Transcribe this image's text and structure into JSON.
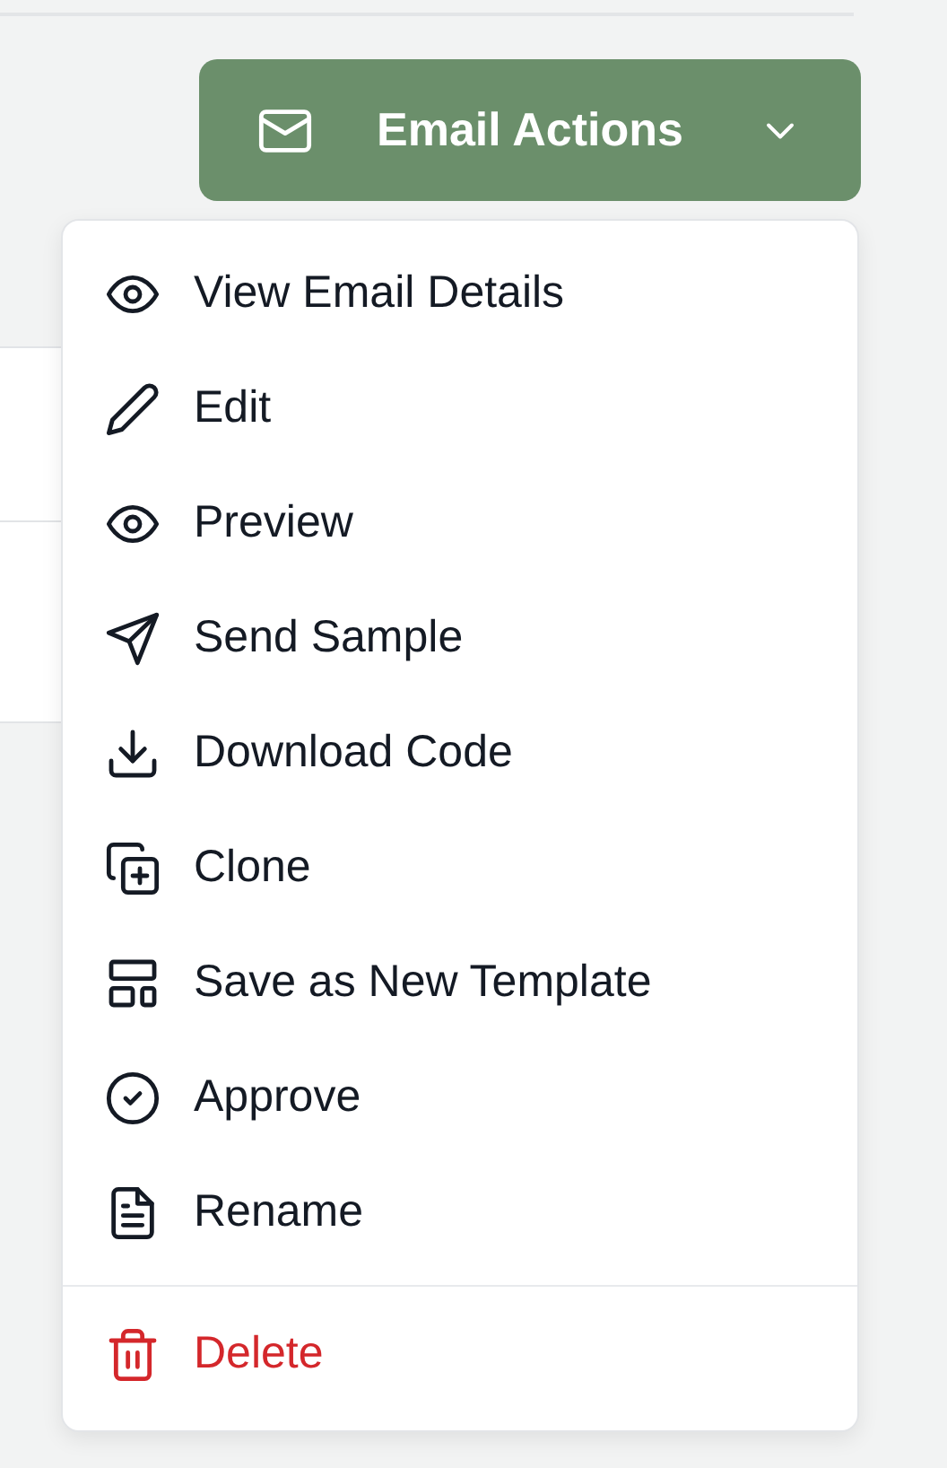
{
  "actions_button": {
    "label": "Email Actions",
    "expanded": true
  },
  "menu": [
    {
      "label": "View Email Details",
      "kind": "normal"
    },
    {
      "label": "Edit",
      "kind": "normal"
    },
    {
      "label": "Preview",
      "kind": "normal"
    },
    {
      "label": "Send Sample",
      "kind": "normal"
    },
    {
      "label": "Download Code",
      "kind": "normal"
    },
    {
      "label": "Clone",
      "kind": "normal"
    },
    {
      "label": "Save as New Template",
      "kind": "normal"
    },
    {
      "label": "Approve",
      "kind": "normal"
    },
    {
      "label": "Rename",
      "kind": "normal"
    },
    {
      "label": "Delete",
      "kind": "danger"
    }
  ]
}
